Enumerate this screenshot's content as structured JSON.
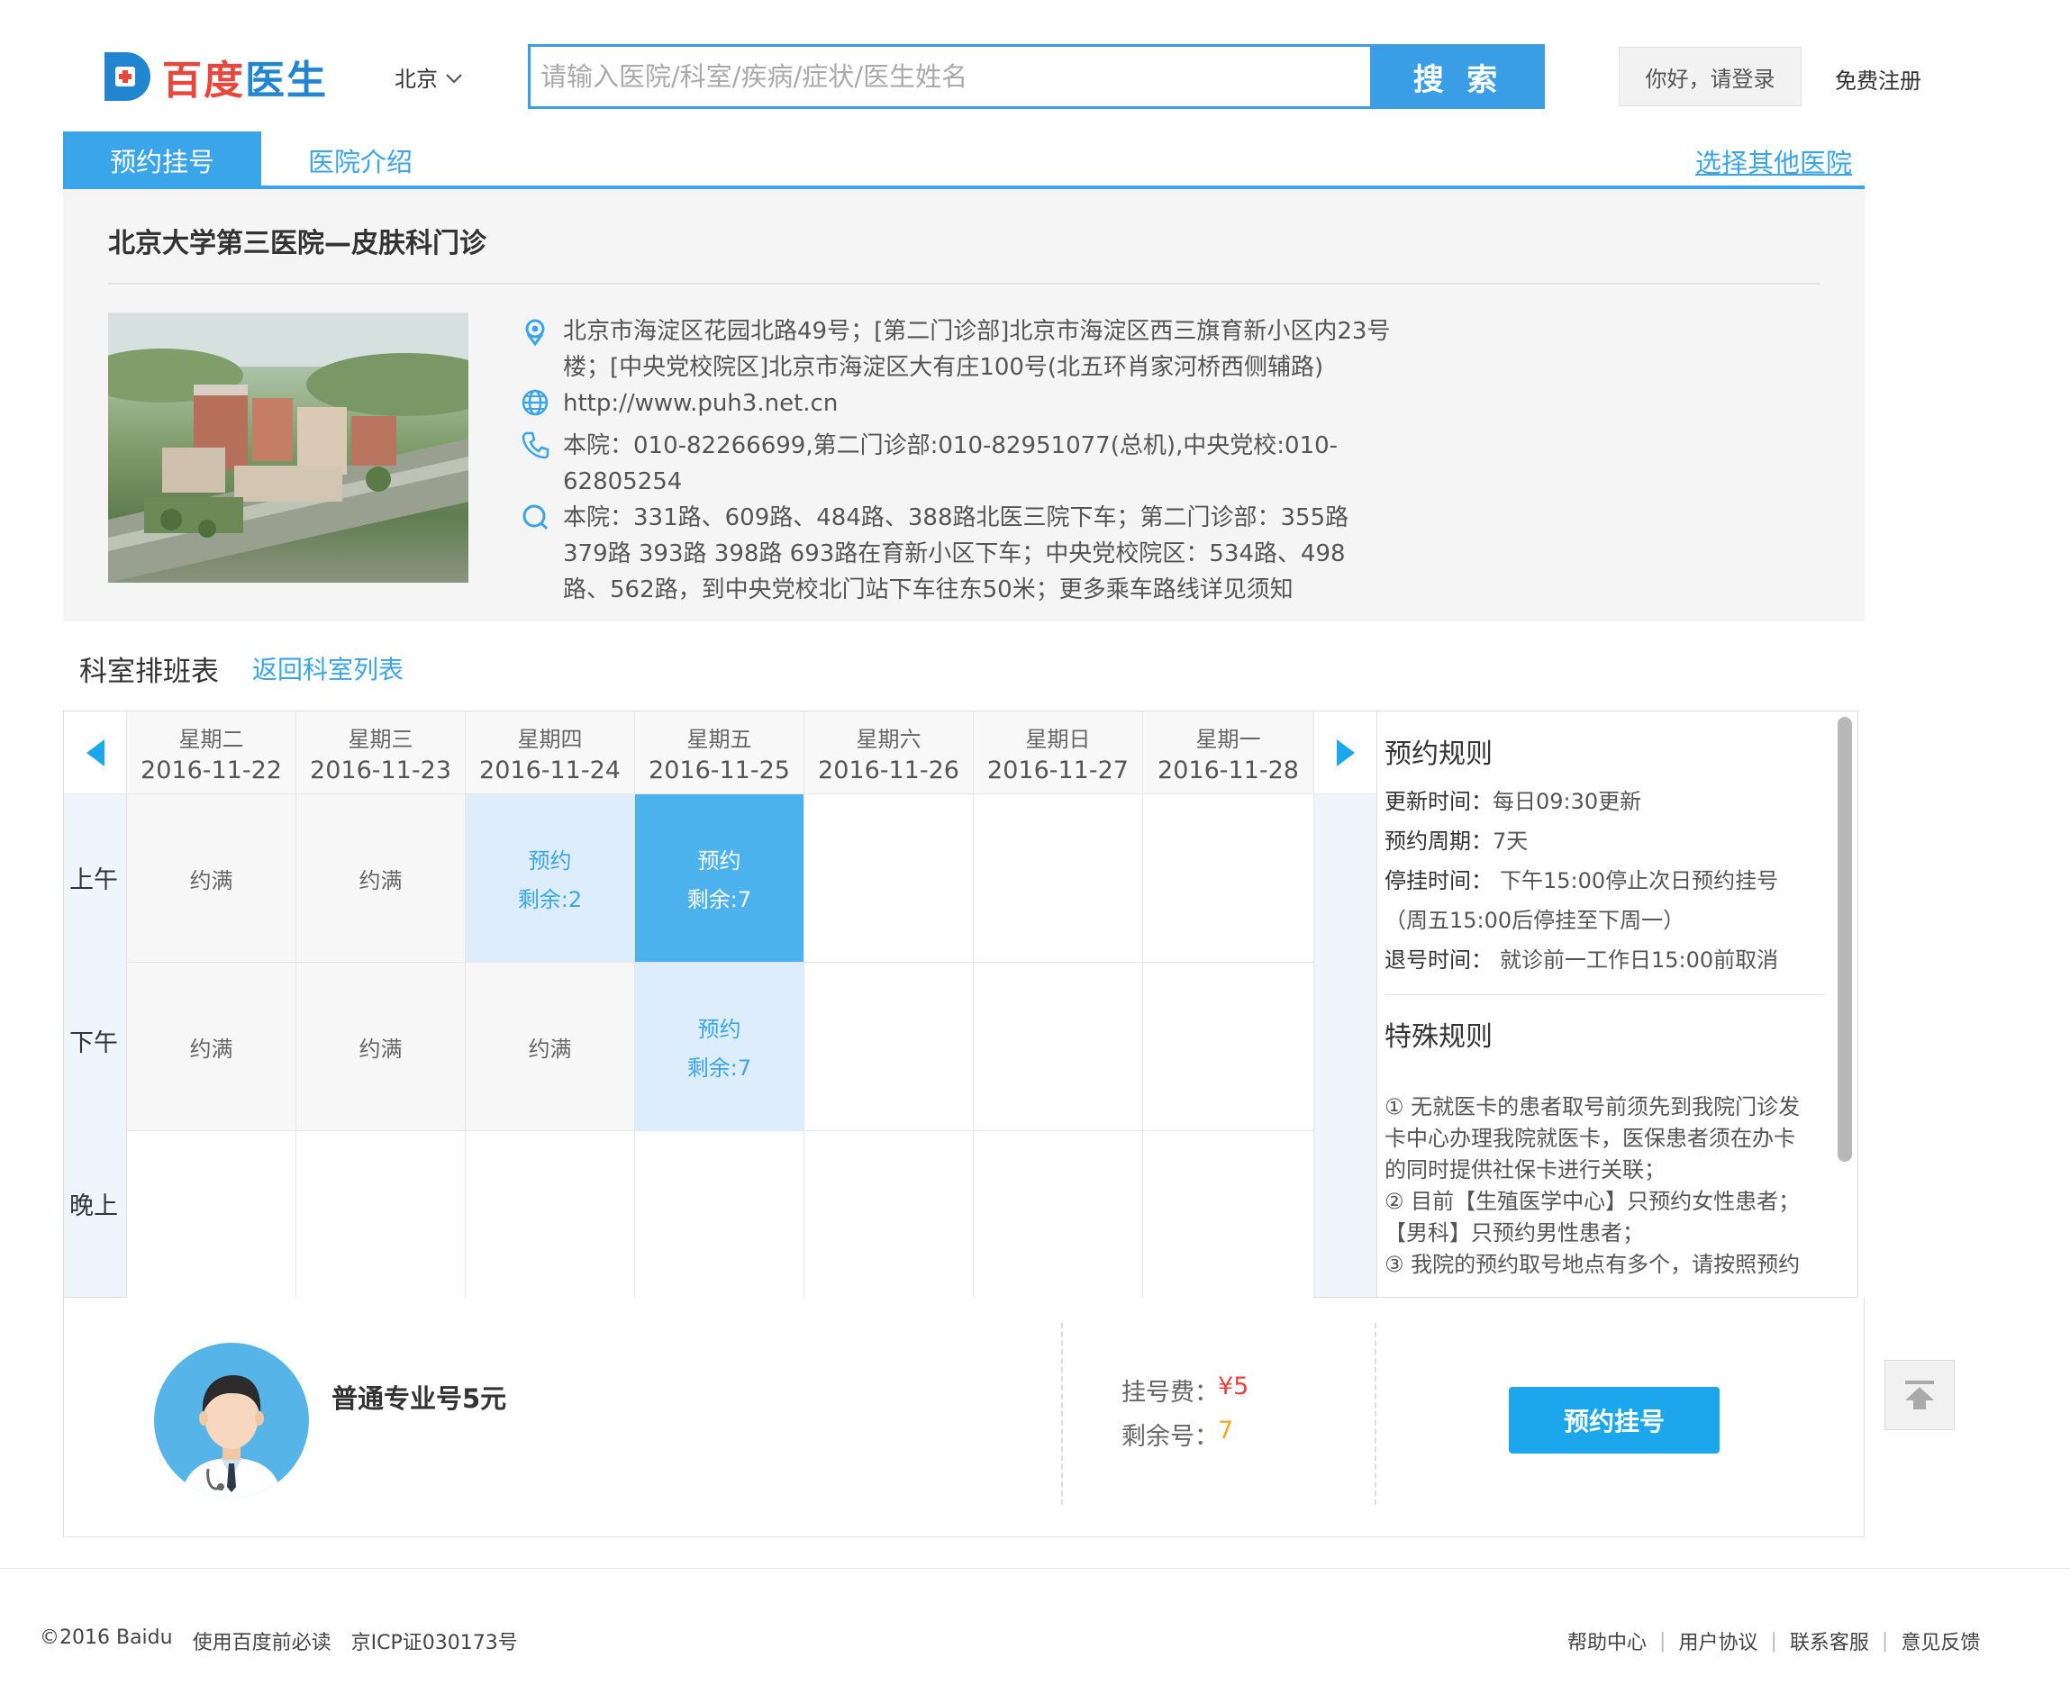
{
  "header": {
    "brand_part1": "百度",
    "brand_part2": "医生",
    "city": "北京",
    "search_placeholder": "请输入医院/科室/疾病/症状/医生姓名",
    "search_button": "搜 索",
    "login": "你好，请登录",
    "register": "免费注册"
  },
  "tabs": {
    "active": "预约挂号",
    "intro": "医院介绍",
    "other": "选择其他医院"
  },
  "hospital": {
    "name": "北京大学第三医院—皮肤科门诊",
    "address_line1": "北京市海淀区花园北路49号；[第二门诊部]北京市海淀区西三旗育新小区内23号",
    "address_line2": "楼；[中央党校院区]北京市海淀区大有庄100号(北五环肖家河桥西侧辅路)",
    "website": "http://www.puh3.net.cn",
    "phone_line1": "本院：010-82266699,第二门诊部:010-82951077(总机),中央党校:010-",
    "phone_line2": "62805254",
    "transit_line1": "本院：331路、609路、484路、388路北医三院下车；第二门诊部：355路",
    "transit_line2": "379路 393路 398路 693路在育新小区下车；中央党校院区：534路、498",
    "transit_line3": "路、562路，到中央党校北门站下车往东50米；更多乘车路线详见须知"
  },
  "schedule": {
    "title": "科室排班表",
    "back": "返回科室列表",
    "days": [
      {
        "weekday": "星期二",
        "date": "2016-11-22"
      },
      {
        "weekday": "星期三",
        "date": "2016-11-23"
      },
      {
        "weekday": "星期四",
        "date": "2016-11-24"
      },
      {
        "weekday": "星期五",
        "date": "2016-11-25"
      },
      {
        "weekday": "星期六",
        "date": "2016-11-26"
      },
      {
        "weekday": "星期日",
        "date": "2016-11-27"
      },
      {
        "weekday": "星期一",
        "date": "2016-11-28"
      }
    ],
    "periods": [
      "上午",
      "下午",
      "晚上"
    ],
    "full_label": "约满",
    "book_label": "预约",
    "am_thu_remain": "剩余:2",
    "am_fri_remain": "剩余:7",
    "pm_fri_remain": "剩余:7"
  },
  "rules": {
    "title": "预约规则",
    "update_label": "更新时间：",
    "update_value": "每日09:30更新",
    "cycle_label": "预约周期：",
    "cycle_value": "7天",
    "stop_label": "停挂时间：",
    "stop_value": "下午15:00停止次日预约挂号",
    "stop_note": "（周五15:00后停挂至下周一）",
    "cancel_label": "退号时间：",
    "cancel_value": "就诊前一工作日15:00前取消",
    "special_title": "特殊规则",
    "special_1a": "① 无就医卡的患者取号前须先到我院门诊发",
    "special_1b": "卡中心办理我院就医卡，医保患者须在办卡",
    "special_1c": "的同时提供社保卡进行关联；",
    "special_2a": "② 目前【生殖医学中心】只预约女性患者；",
    "special_2b": "【男科】只预约男性患者；",
    "special_3a": "③ 我院的预约取号地点有多个，请按照预约"
  },
  "booking": {
    "ticket_name": "普通专业号5元",
    "fee_label": "挂号费：",
    "fee_value": "¥5",
    "remain_label": "剩余号：",
    "remain_value": "7",
    "button": "预约挂号"
  },
  "footer": {
    "copyright": "©2016 Baidu",
    "must_read": "使用百度前必读",
    "icp": "京ICP证030173号",
    "help": "帮助中心",
    "agreement": "用户协议",
    "service": "联系客服",
    "feedback": "意见反馈"
  },
  "colors": {
    "accent": "#3aa5e8",
    "brand_red": "#e8453c",
    "selected_cell": "#4bb2ee",
    "available_cell": "#deedfb",
    "remain_orange": "#f5a623"
  }
}
